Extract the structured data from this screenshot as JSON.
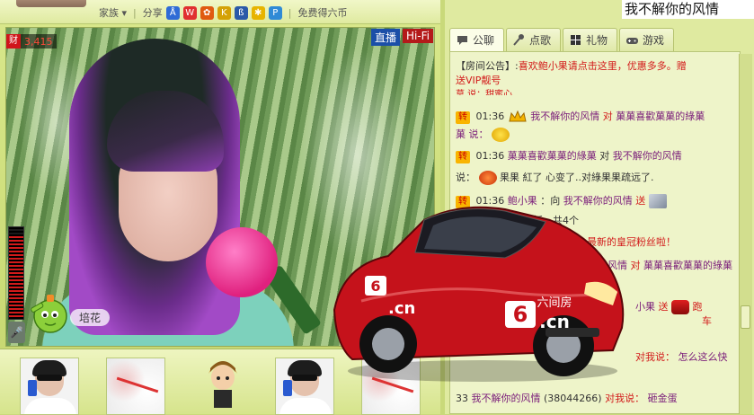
{
  "window": {
    "title": "我不解你的风情"
  },
  "toolbar": {
    "family_label": "家族",
    "share_label": "分享",
    "earn_label": "免费得六币"
  },
  "video": {
    "live_badge": "直播",
    "hifi_badge": "Hi-Fi",
    "coin_icon": "财",
    "coin_count": "3,415",
    "mascot_label": "培花"
  },
  "tabs": [
    {
      "label": "公聊",
      "icon": "chat-bubble-icon"
    },
    {
      "label": "点歌",
      "icon": "microphone-icon"
    },
    {
      "label": "礼物",
      "icon": "gift-icon"
    },
    {
      "label": "游戏",
      "icon": "gamepad-icon"
    }
  ],
  "chat": {
    "announce_prefix": "【房间公告】:",
    "announce_text": "喜欢鲍小果请点击这里，优惠多多。赠",
    "announce_text2": "送VIP靓号",
    "cut_line": "莫 说：甜蜜心",
    "zhuan": "转",
    "lines": [
      {
        "time": "01:36",
        "from": "我不解你的风情",
        "verb": "对",
        "to": "菓菓喜歡菓菓的綠菓",
        "cont": "菓 说："
      },
      {
        "time": "01:36",
        "from": "菓菓喜歡菓菓的綠菓",
        "verb": "对",
        "to": "我不解你的风情",
        "cont": "说：",
        "msg": "果果 紅了  心变了..对綠果果疏远了."
      },
      {
        "time": "01:36",
        "from": "鲍小果",
        "verb": "：向",
        "to": "我不解你的风情",
        "cont": "送"
      },
      {
        "cont": "搓衣板，共4个"
      },
      {
        "cont": "的风情\"成为最新的皇冠粉丝啦！"
      },
      {
        "from": "我不解你的风情",
        "verb": "对",
        "to": "菓菓喜歡菓菓的綠菓"
      },
      {
        "cont": "小果",
        "verb": "送",
        "msg": "跑"
      },
      {
        "cont": "车"
      },
      {
        "from": "对我说：",
        "msg": "怎么这么快"
      },
      {
        "time": "33",
        "from": "我不解你的风情",
        "id": "(38044266)",
        "verb": "对我说：",
        "msg": "砸金蛋"
      }
    ]
  },
  "car": {
    "plate_text": "六间房",
    "logo_num": "6",
    "logo_domain": ".cn"
  },
  "colors": {
    "accent_red": "#d21a1a",
    "panel_green": "#dfeaa0",
    "live_blue": "#1b4fa8"
  }
}
